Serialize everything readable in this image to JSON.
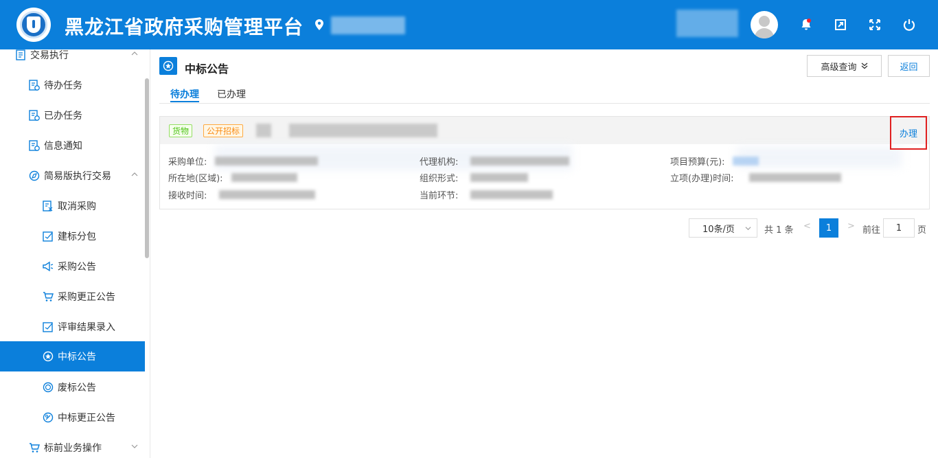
{
  "header": {
    "app_title": "黑龙江省政府采购管理平台",
    "icons": [
      "location-icon",
      "bell-icon",
      "export-icon",
      "fullscreen-icon",
      "power-icon"
    ]
  },
  "sidebar": {
    "items": [
      {
        "label": "交易执行",
        "icon": "document-icon"
      },
      {
        "label": "待办任务",
        "icon": "task-icon"
      },
      {
        "label": "已办任务",
        "icon": "task-icon"
      },
      {
        "label": "信息通知",
        "icon": "notice-icon"
      },
      {
        "label": "简易版执行交易",
        "icon": "compass-icon"
      },
      {
        "label": "取消采购",
        "icon": "cancel-doc-icon"
      },
      {
        "label": "建标分包",
        "icon": "edit-icon"
      },
      {
        "label": "采购公告",
        "icon": "megaphone-icon"
      },
      {
        "label": "采购更正公告",
        "icon": "cart-icon"
      },
      {
        "label": "评审结果录入",
        "icon": "edit-icon"
      },
      {
        "label": "中标公告",
        "icon": "award-icon"
      },
      {
        "label": "废标公告",
        "icon": "stamp-icon"
      },
      {
        "label": "中标更正公告",
        "icon": "award-edit-icon"
      },
      {
        "label": "标前业务操作",
        "icon": "cart-icon"
      }
    ],
    "active_color": "#0b7fdb"
  },
  "main": {
    "title": "中标公告",
    "buttons": {
      "advanced_search": "高级查询",
      "back": "返回"
    },
    "tabs": [
      {
        "label": "待办理"
      },
      {
        "label": "已办理"
      }
    ],
    "record": {
      "tags": [
        "货物",
        "公开招标"
      ],
      "action": "办理",
      "fields": {
        "purchaser": "采购单位:",
        "agency": "代理机构:",
        "budget": "项目预算(元):",
        "region": "所在地(区域):",
        "org_form": "组织形式:",
        "approval_time": "立项(办理)时间:",
        "receive_time": "接收时间:",
        "current_stage": "当前环节:"
      }
    },
    "pagination": {
      "page_size": "10条/页",
      "total": "共 1 条",
      "prev": "<",
      "current_page": "1",
      "next": ">",
      "goto_label": "前往",
      "goto_value": "1",
      "page_unit": "页"
    }
  },
  "colors": {
    "primary": "#0b7fdb",
    "green_tag": "#52c41a",
    "orange_tag": "#fa8c16",
    "highlight_box": "#e02020"
  }
}
